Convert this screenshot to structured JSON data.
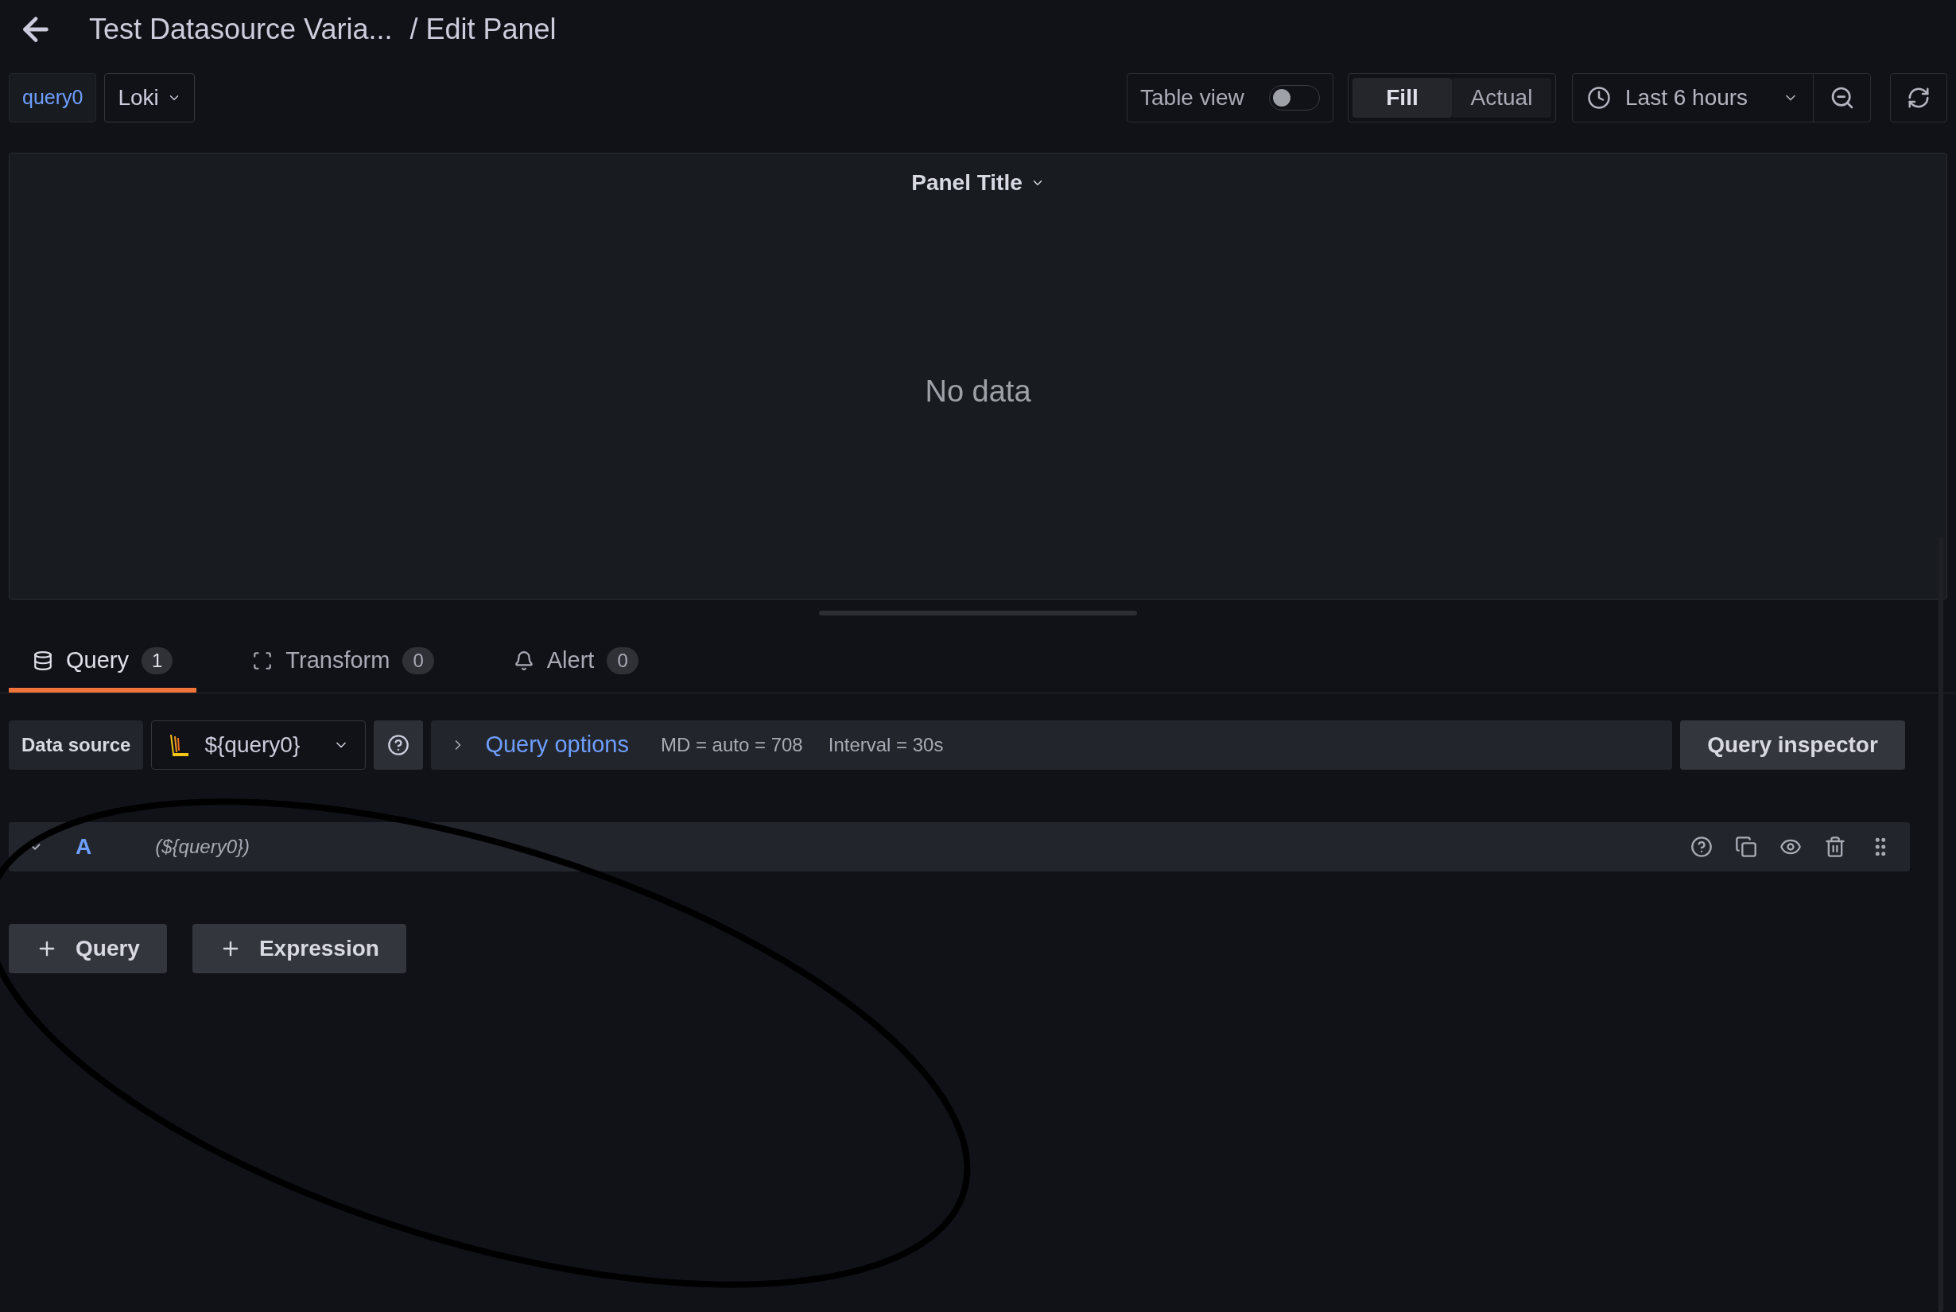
{
  "header": {
    "title": "Test Datasource Varia...",
    "subtitle": "/ Edit Panel"
  },
  "variable": {
    "label": "query0",
    "value": "Loki"
  },
  "toolbar": {
    "table_view": {
      "label": "Table view",
      "on": false
    },
    "view_modes": [
      {
        "label": "Fill",
        "selected": true
      },
      {
        "label": "Actual",
        "selected": false
      }
    ],
    "time_range": "Last 6 hours"
  },
  "panel": {
    "title": "Panel Title",
    "message": "No data"
  },
  "tabs": [
    {
      "label": "Query",
      "count": "1",
      "selected": true
    },
    {
      "label": "Transform",
      "count": "0",
      "selected": false
    },
    {
      "label": "Alert",
      "count": "0",
      "selected": false
    }
  ],
  "data_source": {
    "label": "Data source",
    "value": "${query0}",
    "query_options": "Query options",
    "max_data_points": "MD = auto = 708",
    "interval": "Interval = 30s",
    "inspector": "Query inspector"
  },
  "queries": [
    {
      "ref": "A",
      "text": "(${query0})"
    }
  ],
  "add_buttons": [
    "Query",
    "Expression"
  ]
}
